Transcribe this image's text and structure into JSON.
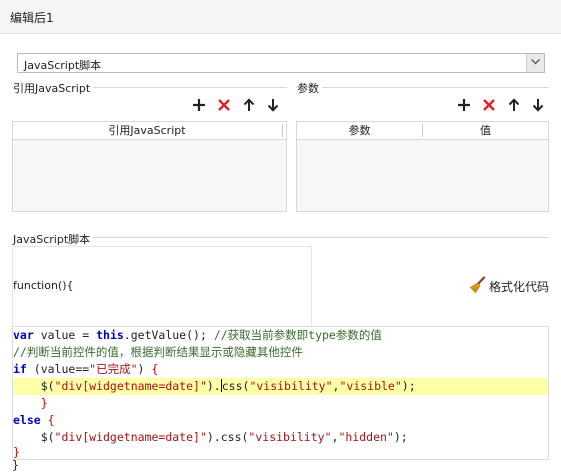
{
  "window": {
    "title": "编辑后1"
  },
  "script_type": {
    "selected": "JavaScript脚本"
  },
  "ref_js": {
    "label": "引用JavaScript",
    "column": "引用JavaScript"
  },
  "params": {
    "label": "参数",
    "columns": [
      "参数",
      "值"
    ]
  },
  "toolbar_icons": [
    "add-icon",
    "delete-icon",
    "move-up-icon",
    "move-down-icon"
  ],
  "script": {
    "label": "JavaScript脚本",
    "function_header": "function(){",
    "format_label": "格式化代码",
    "closing_brace": "}"
  },
  "code": {
    "l1_kw": "var",
    "l1_a": " value = ",
    "l1_this": "this",
    "l1_b": ".getValue(); ",
    "l1_cm": "//获取当前参数即type参数的值",
    "l2_cm": "//判断当前控件的值，根据判断结果显示或隐藏其他控件",
    "l3_kw": "if",
    "l3_a": " (value==",
    "l3_str": "\"已完成\"",
    "l3_b": ") ",
    "l3_brace": "{",
    "l4_indent": "    $(",
    "l4_str1": "\"div[widgetname=date]\"",
    "l4_a": ").",
    "l4_b": "css(",
    "l4_str2": "\"visibility\"",
    "l4_comma": ",",
    "l4_str3": "\"visible\"",
    "l4_c": ");",
    "l5_brace": "    }",
    "l6_kw": "else",
    "l6_brace": " {",
    "l7_indent": "    $(",
    "l7_str1": "\"div[widgetname=date]\"",
    "l7_a": ").css(",
    "l7_str2": "\"visibility\"",
    "l7_comma": ",",
    "l7_str3": "\"hidden\"",
    "l7_c": ");",
    "l8_brace": "}"
  },
  "colors": {
    "keyword": "#0000c8",
    "string": "#a31515",
    "comment": "#3a6b2e",
    "brace": "#d40000",
    "highlight": "#ffffa8"
  }
}
